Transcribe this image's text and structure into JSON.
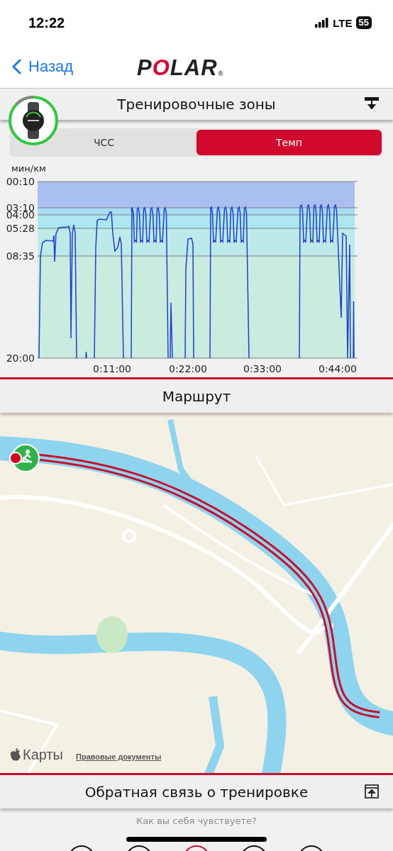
{
  "status_bar": {
    "time": "12:22",
    "network": "LTE",
    "battery": "55"
  },
  "nav": {
    "back": "Назад",
    "logo": "POLAR",
    "logo_mark": "®"
  },
  "zones": {
    "title": "Тренировочные зоны",
    "tabs": [
      {
        "label": "ЧСС",
        "selected": false
      },
      {
        "label": "Темп",
        "selected": true
      }
    ],
    "unit": "мин/км",
    "y_ticks": [
      "00:10",
      "03:10",
      "04:00",
      "05:28",
      "08:35",
      "20:00"
    ],
    "x_ticks": [
      "0:11:00",
      "0:22:00",
      "0:33:00",
      "0:44:00"
    ]
  },
  "route": {
    "title": "Маршрут",
    "maps_label": "Карты",
    "legal_link": "Правовые документы"
  },
  "feedback": {
    "title": "Обратная связь о тренировке",
    "prompt": "Как вы себя чувствуете?",
    "moods": [
      {
        "selected": false
      },
      {
        "selected": false
      },
      {
        "selected": true
      },
      {
        "selected": false
      },
      {
        "selected": false
      }
    ]
  }
}
